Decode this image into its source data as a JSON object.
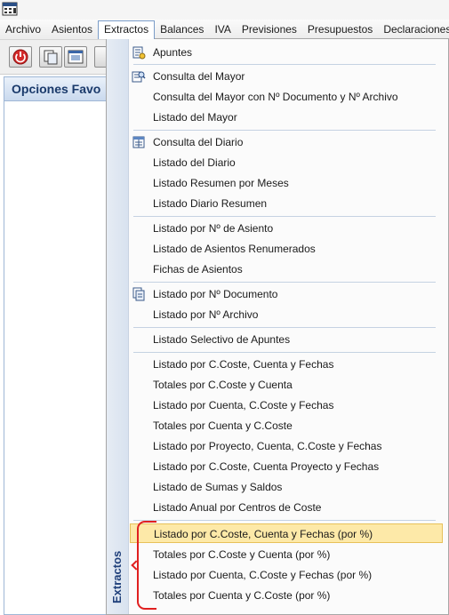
{
  "menubar": {
    "items": [
      "Archivo",
      "Asientos",
      "Extractos",
      "Balances",
      "IVA",
      "Previsiones",
      "Presupuestos",
      "Declaraciones"
    ],
    "active": "Extractos"
  },
  "left_panel": {
    "title": "Opciones Favo"
  },
  "dropdown": {
    "vertical_label": "Extractos",
    "entries": [
      "Apuntes",
      "Consulta del Mayor",
      "Consulta del Mayor con Nº Documento y Nº Archivo",
      "Listado del Mayor",
      "Consulta del Diario",
      "Listado del Diario",
      "Listado Resumen por Meses",
      "Listado Diario Resumen",
      "Listado por Nº de Asiento",
      "Listado de Asientos Renumerados",
      "Fichas de Asientos",
      "Listado por Nº Documento",
      "Listado por Nº Archivo",
      "Listado Selectivo de Apuntes",
      "Listado por C.Coste, Cuenta y Fechas",
      "Totales por C.Coste y Cuenta",
      "Listado por Cuenta, C.Coste y Fechas",
      "Totales por Cuenta y C.Coste",
      "Listado por Proyecto, Cuenta, C.Coste y Fechas",
      "Listado por C.Coste, Cuenta  Proyecto y Fechas",
      "Listado de Sumas y Saldos",
      "Listado Anual por Centros de Coste",
      "Listado por C.Coste, Cuenta y Fechas (por %)",
      "Totales por C.Coste y Cuenta (por %)",
      "Listado por Cuenta, C.Coste y Fechas (por %)",
      "Totales por Cuenta y C.Coste (por %)"
    ],
    "highlighted": "Listado por C.Coste, Cuenta y Fechas (por %)"
  },
  "colors": {
    "highlight": "#fde9a8",
    "accent": "#1f3f7a",
    "bracket": "#e02020"
  },
  "icons": [
    "app-icon",
    "power-icon",
    "copy-icon",
    "window-icon",
    "ledger-icon",
    "ledger-search-icon",
    "journal-icon",
    "document-icon"
  ]
}
